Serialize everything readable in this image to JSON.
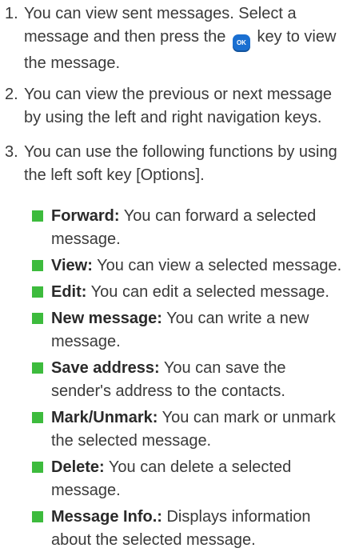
{
  "steps": [
    {
      "number": "1.",
      "before": "You can view sent messages. Select a message and then press the",
      "key_label": "OK",
      "after": "key to view the message."
    },
    {
      "number": "2.",
      "text": "You can view the previous or next message by using the left and right navigation keys."
    },
    {
      "number": "3.",
      "text": "You can use the following functions by using the left soft key [Options]."
    }
  ],
  "options": [
    {
      "term": "Forward:",
      "desc": "You can forward a selected message."
    },
    {
      "term": "View:",
      "desc": "You can view a selected message."
    },
    {
      "term": "Edit:",
      "desc": "You can edit a selected message."
    },
    {
      "term": "New message:",
      "desc": "You can write a new message."
    },
    {
      "term": "Save address:",
      "desc": "You can save the sender's address to the contacts."
    },
    {
      "term": "Mark/Unmark:",
      "desc": "You can mark or unmark the selected message."
    },
    {
      "term": "Delete:",
      "desc": "You can delete a selected message."
    },
    {
      "term": "Message Info.:",
      "desc": "Displays information about the selected message."
    }
  ],
  "colors": {
    "bullet": "#3dbb3d",
    "ok_key": "#1a6fd1",
    "text": "#3a3a3a"
  },
  "icons": {
    "ok_key": "ok-key-icon",
    "bullet": "green-square-bullet"
  }
}
